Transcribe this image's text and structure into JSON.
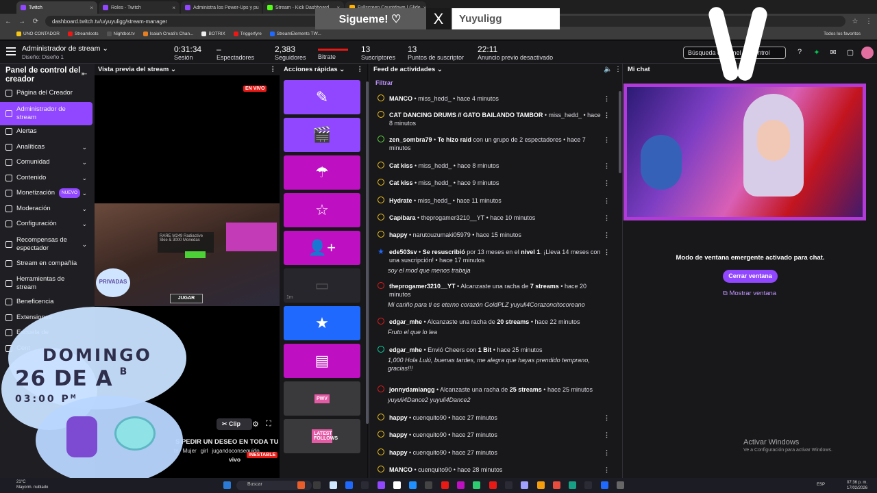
{
  "browser": {
    "tabs": [
      {
        "label": "Twitch",
        "color": "#9147ff",
        "active": true
      },
      {
        "label": "Roles - Twitch",
        "color": "#9147ff",
        "active": false
      },
      {
        "label": "Administra los Power-Ups y pu",
        "color": "#9147ff",
        "active": false
      },
      {
        "label": "Stream - Kick Dashboard",
        "color": "#53fc18",
        "active": false
      },
      {
        "label": "Fullscreen Countdown | Glide",
        "color": "#ffb000",
        "active": false
      }
    ],
    "url": "dashboard.twitch.tv/u/yuyuligg/stream-manager",
    "bookmarks": [
      "UNO CONTADOR",
      "Streamloots",
      "Nightbot.tv",
      "Isaiah Creati's Chan...",
      "BOTRIX",
      "Triggerfyre",
      "StreamElements TW..."
    ],
    "all_bookmarks": "Todos los favoritos"
  },
  "social": {
    "follow": "Sigueme! ♡",
    "x_logo": "X",
    "handle": "Yuyuligg"
  },
  "stats": {
    "title": "Administrador de stream",
    "layout": "Diseño: Diseño 1",
    "items": [
      {
        "value": "0:31:34",
        "label": "Sesión"
      },
      {
        "value": "–",
        "label": "Espectadores"
      },
      {
        "value": "2,383",
        "label": "Seguidores"
      },
      {
        "value": "",
        "label": "Bitrate"
      },
      {
        "value": "13",
        "label": "Suscriptores"
      },
      {
        "value": "13",
        "label": "Puntos de suscriptor"
      },
      {
        "value": "22:11",
        "label": "Anuncio previo desactivado"
      }
    ],
    "search_placeholder": "Búsqueda de panel de control"
  },
  "sidebar": {
    "title": "Panel de control del creador",
    "items": [
      {
        "label": "Página del Creador",
        "chevron": false
      },
      {
        "label": "Administrador de stream",
        "chevron": false,
        "active": true
      },
      {
        "label": "Alertas",
        "chevron": false
      },
      {
        "label": "Analíticas",
        "chevron": true
      },
      {
        "label": "Comunidad",
        "chevron": true
      },
      {
        "label": "Contenido",
        "chevron": true
      },
      {
        "label": "Monetización",
        "chevron": true,
        "badge": "NUEVO"
      },
      {
        "label": "Moderación",
        "chevron": true
      },
      {
        "label": "Configuración",
        "chevron": true
      },
      {
        "label": "Recompensas de espectador",
        "chevron": true
      },
      {
        "label": "Stream en compañía",
        "chevron": false
      },
      {
        "label": "Herramientas de stream",
        "chevron": false
      },
      {
        "label": "Beneficencia",
        "chevron": false
      },
      {
        "label": "Extensiones",
        "chevron": false
      },
      {
        "label": "Escuela de",
        "chevron": false
      },
      {
        "label": "Cent",
        "chevron": false
      }
    ]
  },
  "preview": {
    "title": "Vista previa del stream",
    "live": "EN VIVO",
    "clip": "Clip",
    "ticker": "S PEDIR UN DESEO EN TODA TU VI",
    "tags": [
      "te",
      "Mujer",
      "girl",
      "jugandoconseguido"
    ],
    "vivo": "vivo",
    "unstable": "INESTABLE",
    "game_button": "JUGAR",
    "game_item": "RARE M249 Radiactive Skie & 3000 Monedas",
    "privadas": "PRIVADAS"
  },
  "quick_actions": {
    "title": "Acciones rápidas",
    "tiles": [
      {
        "icon": "pencil-icon",
        "color": "#9147ff"
      },
      {
        "icon": "clapperboard-icon",
        "color": "#9147ff"
      },
      {
        "icon": "parachute-icon",
        "color": "#bf0fc2"
      },
      {
        "icon": "star-outline-icon",
        "color": "#bf0fc2"
      },
      {
        "icon": "add-user-icon",
        "color": "#bf0fc2"
      },
      {
        "icon": "ad-icon",
        "color": "#26262c",
        "label": "1m"
      },
      {
        "icon": "star-filled-icon",
        "color": "#1f69ff"
      },
      {
        "icon": "layout-icon",
        "color": "#bf0fc2"
      },
      {
        "icon": "pwv-icon",
        "color": "#3a3a3d",
        "label": "PWV"
      },
      {
        "icon": "latest-follows-icon",
        "color": "#3a3a3d",
        "label": "LATEST FOLLOWS"
      }
    ]
  },
  "feed": {
    "title": "Feed de actividades",
    "filter": "Filtrar",
    "entries": [
      {
        "type": "reward",
        "parts": [
          {
            "b": "MANCO"
          },
          {
            "t": " • miss_hedd_ • hace 4 minutos"
          }
        ]
      },
      {
        "type": "reward",
        "parts": [
          {
            "b": "CAT DANCING DRUMS // GATO BAILANDO TAMBOR"
          },
          {
            "t": " • miss_hedd_ • hace 8 minutos"
          }
        ]
      },
      {
        "type": "raid",
        "parts": [
          {
            "b": "zen_sombra79"
          },
          {
            "t": " • "
          },
          {
            "b": "Te hizo raid"
          },
          {
            "t": " con un grupo de 2 espectadores • hace 7 minutos"
          }
        ]
      },
      {
        "type": "reward",
        "parts": [
          {
            "b": "Cat kiss"
          },
          {
            "t": " • miss_hedd_ • hace 8 minutos"
          }
        ]
      },
      {
        "type": "reward",
        "parts": [
          {
            "b": "Cat kiss"
          },
          {
            "t": " • miss_hedd_ • hace 9 minutos"
          }
        ]
      },
      {
        "type": "reward",
        "parts": [
          {
            "b": "Hydrate"
          },
          {
            "t": " • miss_hedd_ • hace 11 minutos"
          }
        ]
      },
      {
        "type": "reward",
        "parts": [
          {
            "b": "Capibara"
          },
          {
            "t": " • theprogamer3210__YT • hace 10 minutos"
          }
        ]
      },
      {
        "type": "reward",
        "parts": [
          {
            "b": "happy"
          },
          {
            "t": " • narutouzumaki05979 • hace 15 minutos"
          }
        ]
      },
      {
        "type": "sub",
        "parts": [
          {
            "b": "ede503sv"
          },
          {
            "t": " • "
          },
          {
            "b": "Se resuscribió"
          },
          {
            "t": " por 13 meses en el "
          },
          {
            "b": "nivel 1"
          },
          {
            "t": ". ¡Lleva 14 meses con una suscripción! • hace 17 minutos"
          }
        ],
        "message": "soy el mod que menos trabaja"
      },
      {
        "type": "streak",
        "parts": [
          {
            "b": "theprogamer3210__YT"
          },
          {
            "t": " • Alcanzaste una racha de "
          },
          {
            "b": "7 streams"
          },
          {
            "t": " • hace 20 minutos"
          }
        ],
        "message": "Mi cariño para ti es eterno corazón GoldPLZ yuyuli4Corazoncitocoreano"
      },
      {
        "type": "streak",
        "parts": [
          {
            "b": "edgar_mhe"
          },
          {
            "t": " • Alcanzaste una racha de "
          },
          {
            "b": "20 streams"
          },
          {
            "t": " • hace 22 minutos"
          }
        ],
        "message": "Fruto el que lo lea"
      },
      {
        "type": "cheer",
        "parts": [
          {
            "b": "edgar_mhe"
          },
          {
            "t": " • Envió Cheers con "
          },
          {
            "b": "1 Bit"
          },
          {
            "t": " • hace 25 minutos"
          }
        ],
        "message": "1,000 Hola Lulú, buenas tardes, me alegra que hayas prendido temprano, gracias!!!"
      },
      {
        "type": "streak",
        "parts": [
          {
            "b": "jonnydamiangg"
          },
          {
            "t": " • Alcanzaste una racha de "
          },
          {
            "b": "25 streams"
          },
          {
            "t": " • hace 25 minutos"
          }
        ],
        "message": "yuyuli4Dance2 yuyuli4Dance2"
      },
      {
        "type": "reward",
        "parts": [
          {
            "b": "happy"
          },
          {
            "t": " • cuenquito90 • hace 27 minutos"
          }
        ]
      },
      {
        "type": "reward",
        "parts": [
          {
            "b": "happy"
          },
          {
            "t": " • cuenquito90 • hace 27 minutos"
          }
        ]
      },
      {
        "type": "reward",
        "parts": [
          {
            "b": "happy"
          },
          {
            "t": " • cuenquito90 • hace 27 minutos"
          }
        ]
      },
      {
        "type": "reward",
        "parts": [
          {
            "b": "MANCO"
          },
          {
            "t": " • cuenquito90 • hace 28 minutos"
          }
        ]
      }
    ]
  },
  "chat": {
    "title": "Mi chat",
    "popup_text": "Modo de ventana emergente activado para chat.",
    "close_button": "Cerrar ventana",
    "show_link": "Mostrar ventana",
    "activate_title": "Activar Windows",
    "activate_sub": "Ve a Configuración para activar Windows."
  },
  "schedule": {
    "day": "DOMINGO",
    "date": "26 DE A",
    "date_suffix": "B",
    "time": "03:00 P",
    "time_suffix": "M"
  },
  "taskbar": {
    "temp": "21°C",
    "weather": "Mayorm. nublado",
    "search": "Buscar",
    "lang": "ESP",
    "time": "07:36 p. m.",
    "date": "17/02/2026"
  }
}
